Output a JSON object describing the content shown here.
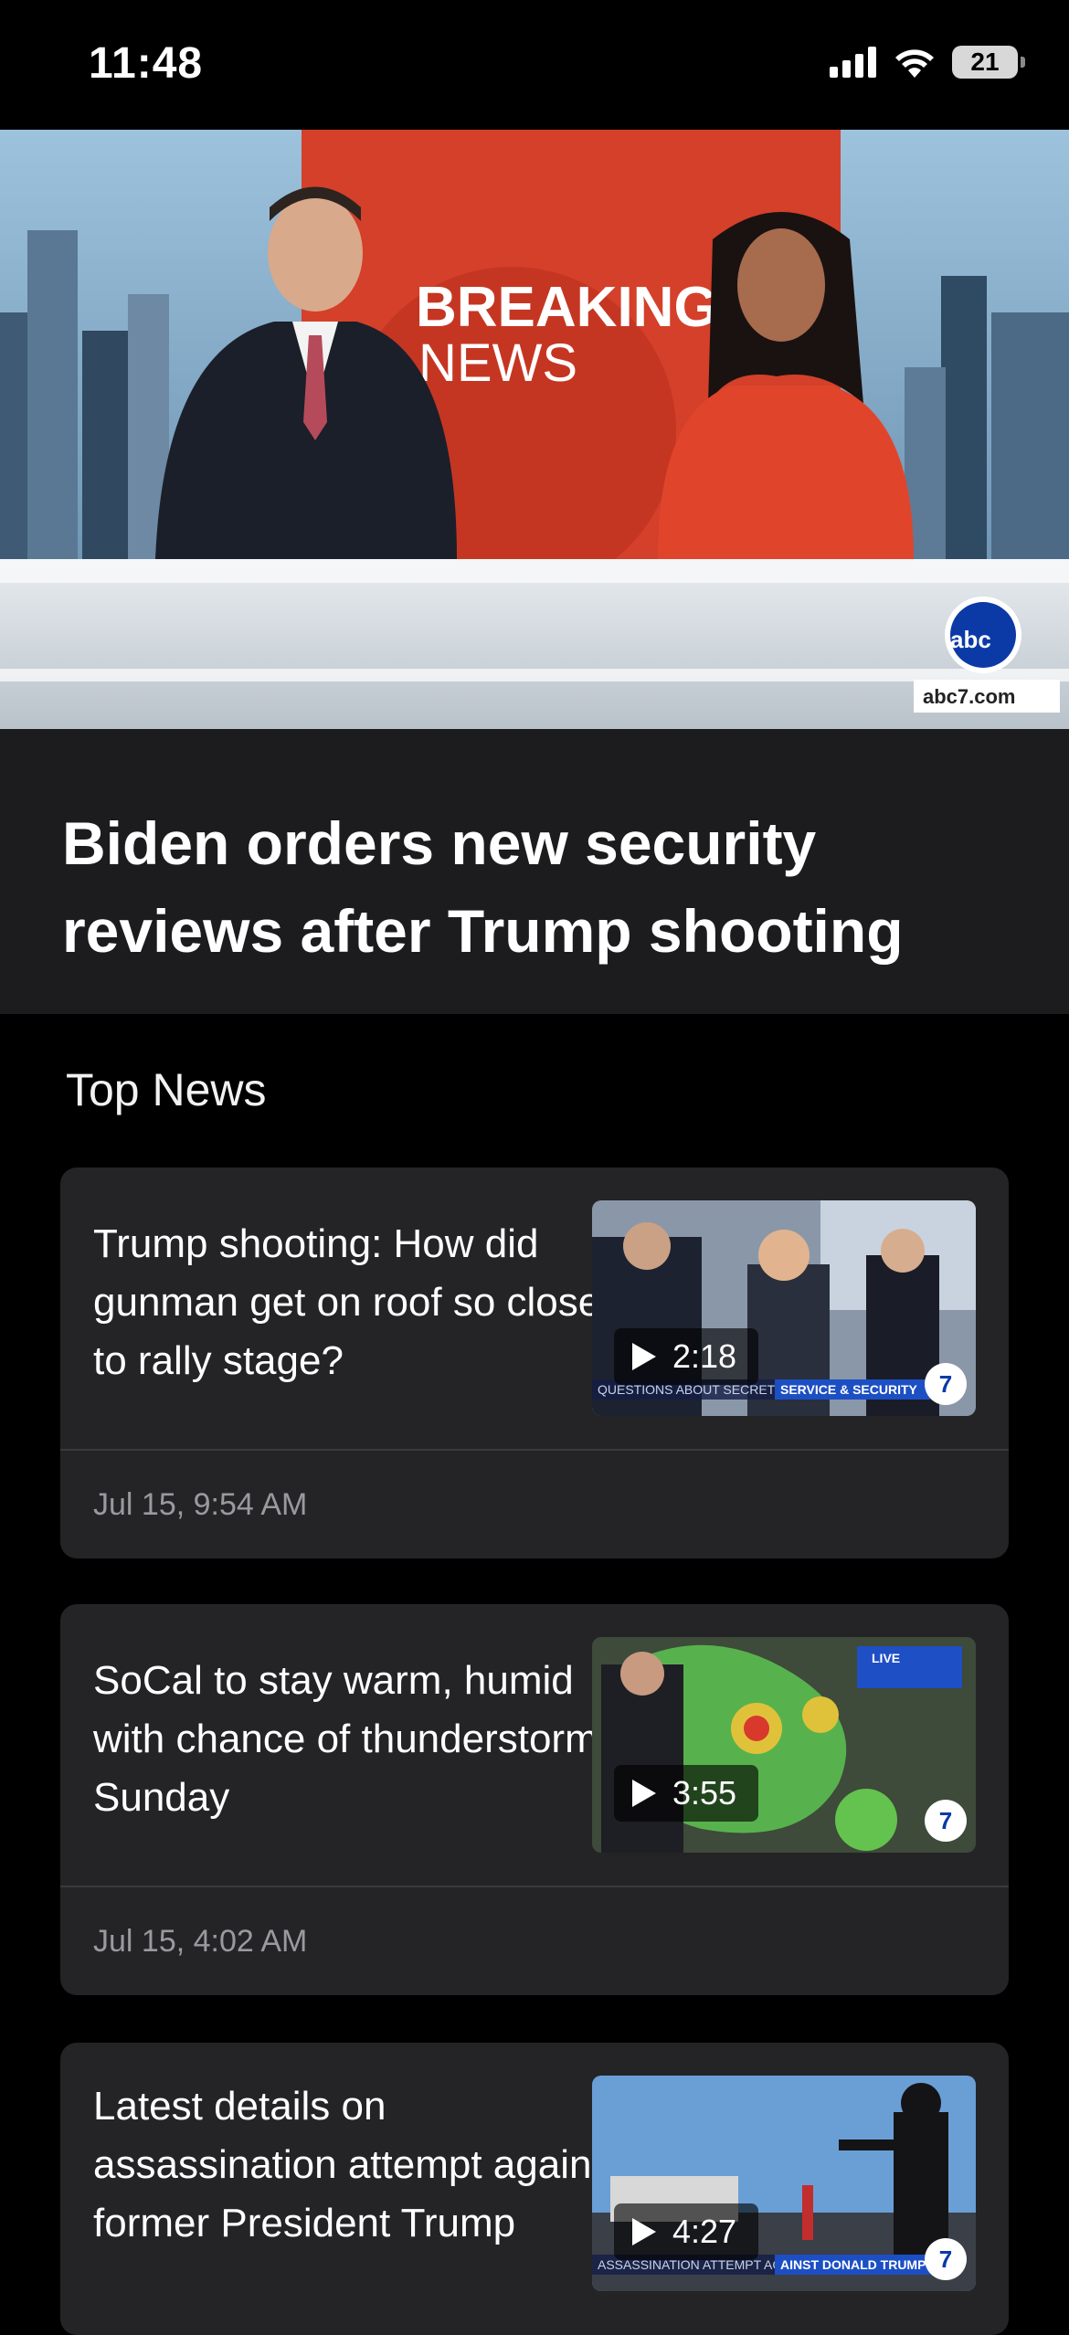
{
  "status_bar": {
    "time": "11:48",
    "battery": "21"
  },
  "hero": {
    "image_text": {
      "breaking": "BREAKING",
      "news": "NEWS",
      "watermark": "abc7.com",
      "logo": "abc"
    },
    "headline": "Biden orders new security reviews after Trump shooting"
  },
  "section": {
    "title": "Top News"
  },
  "stories": [
    {
      "title": "Trump shooting: How did gunman get on roof so close to rally stage?",
      "duration": "2:18",
      "timestamp": "Jul 15, 9:54 AM",
      "banner_left": "QUESTIONS ABOUT SECRET",
      "banner_right": "SERVICE & SECURITY"
    },
    {
      "title": "SoCal to stay warm, humid with chance of thunderstorms Sunday",
      "duration": "3:55",
      "timestamp": "Jul 15, 4:02 AM",
      "live": "LIVE"
    },
    {
      "title": "Latest details on assassination attempt against former President Trump",
      "duration": "4:27",
      "banner_left": "ASSASSINATION ATTEMPT AG",
      "banner_right": "AINST DONALD TRUMP"
    }
  ]
}
